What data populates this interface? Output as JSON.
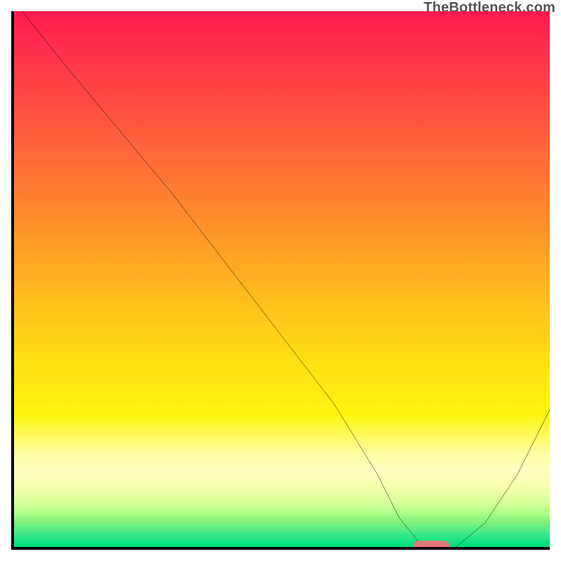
{
  "watermark": "TheBottleneck.com",
  "chart_data": {
    "type": "line",
    "title": "",
    "xlabel": "",
    "ylabel": "",
    "xlim": [
      0,
      100
    ],
    "ylim": [
      0,
      100
    ],
    "grid": false,
    "series": [
      {
        "name": "bottleneck-curve",
        "x": [
          2,
          10,
          20,
          25,
          30,
          40,
          50,
          60,
          68,
          72,
          76,
          78,
          82,
          88,
          94,
          100
        ],
        "y": [
          100,
          90,
          78,
          72,
          66,
          53,
          40,
          27,
          14,
          6,
          1,
          0,
          0,
          5,
          14,
          26
        ],
        "color": "#000000"
      }
    ],
    "marker": {
      "name": "target-marker",
      "x": 78,
      "y": 0.6,
      "color": "#e07878"
    },
    "background": {
      "type": "vertical-gradient",
      "stops": [
        {
          "pos": 0.0,
          "color": "#ff1a4e"
        },
        {
          "pos": 0.22,
          "color": "#ff5a3d"
        },
        {
          "pos": 0.52,
          "color": "#ffb81e"
        },
        {
          "pos": 0.75,
          "color": "#fff410"
        },
        {
          "pos": 0.88,
          "color": "#f8ffb0"
        },
        {
          "pos": 1.0,
          "color": "#00d87a"
        }
      ]
    }
  }
}
